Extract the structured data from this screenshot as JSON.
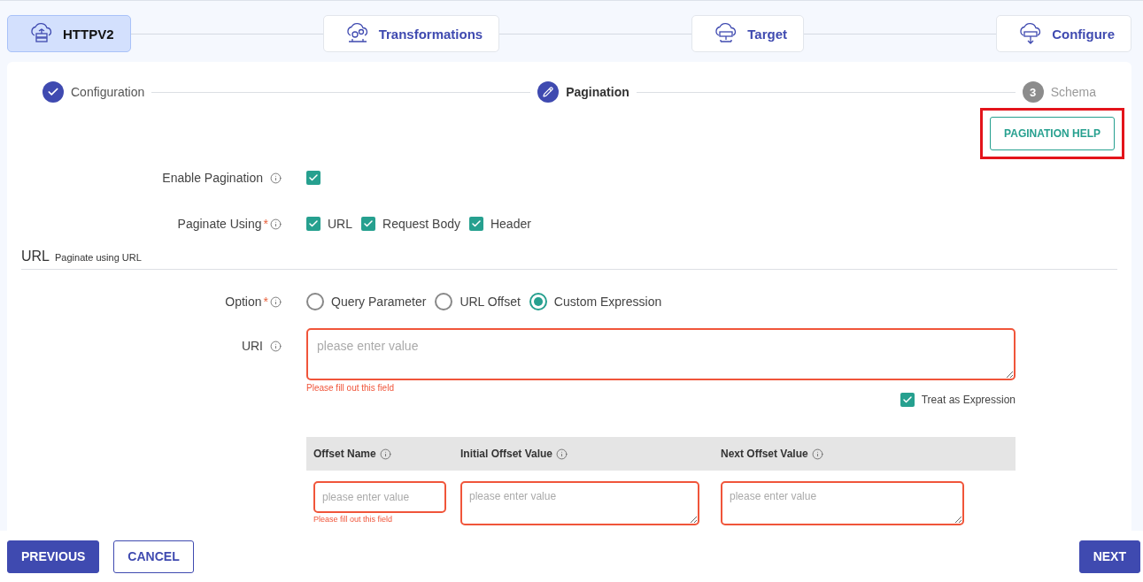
{
  "pipeline": [
    {
      "label": "HTTPV2",
      "selected": true,
      "kind": "source"
    },
    {
      "label": "Transformations",
      "selected": false,
      "kind": "transform"
    },
    {
      "label": "Target",
      "selected": false,
      "kind": "target"
    },
    {
      "label": "Configure",
      "selected": false,
      "kind": "configure"
    }
  ],
  "steps": [
    {
      "label": "Configuration",
      "completed": true,
      "selected": false
    },
    {
      "label": "Pagination",
      "completed": false,
      "selected": true
    },
    {
      "label": "Schema",
      "completed": false,
      "selected": false,
      "number": "3"
    }
  ],
  "help_button": {
    "label": "PAGINATION HELP",
    "highlighted": true
  },
  "enable_pagination": {
    "label": "Enable Pagination",
    "checked": true
  },
  "paginate_using": {
    "label": "Paginate Using",
    "required_mark": "*",
    "options": [
      {
        "label": "URL",
        "checked": true
      },
      {
        "label": "Request Body",
        "checked": true
      },
      {
        "label": "Header",
        "checked": true
      }
    ]
  },
  "section": {
    "title": "URL",
    "subtitle": "Paginate using URL"
  },
  "option": {
    "label": "Option",
    "required_mark": "*",
    "choices": [
      {
        "label": "Query Parameter",
        "selected": false
      },
      {
        "label": "URL Offset",
        "selected": false
      },
      {
        "label": "Custom Expression",
        "selected": true
      }
    ]
  },
  "uri": {
    "label": "URI",
    "placeholder": "please enter value",
    "error": "Please fill out this field",
    "treat_as_expression": {
      "label": "Treat as Expression",
      "checked": true
    }
  },
  "offset_table": {
    "columns": [
      "Offset Name",
      "Initial Offset Value",
      "Next Offset Value"
    ],
    "cells": [
      {
        "kind": "input",
        "placeholder": "please enter value",
        "error": "Please fill out this field"
      },
      {
        "kind": "textarea",
        "placeholder": "please enter value"
      },
      {
        "kind": "textarea",
        "placeholder": "please enter value"
      }
    ]
  },
  "footer": {
    "previous": "PREVIOUS",
    "cancel": "CANCEL",
    "next": "NEXT"
  }
}
